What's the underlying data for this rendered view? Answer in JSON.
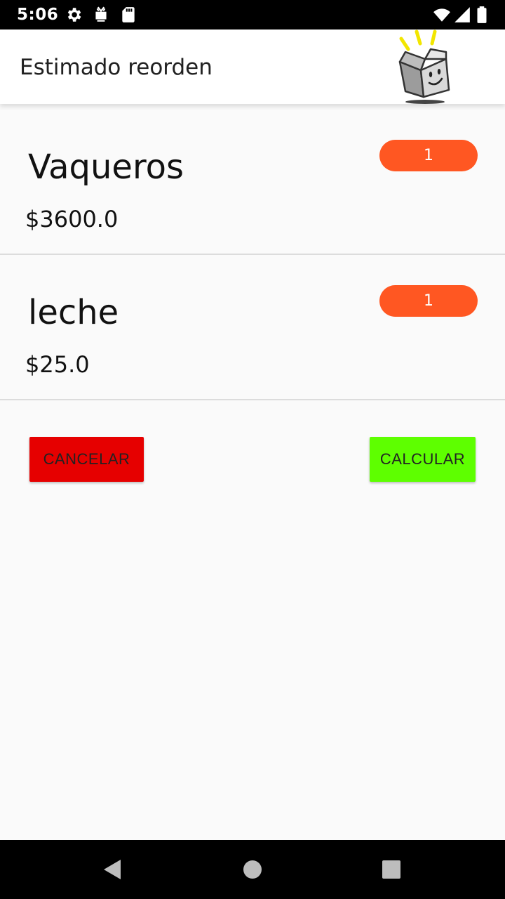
{
  "status_bar": {
    "time": "5:06",
    "icons_left": [
      "gear-icon",
      "tv-notification-icon",
      "sd-card-icon"
    ],
    "icons_right": [
      "wifi-icon",
      "cell-signal-icon",
      "battery-icon"
    ]
  },
  "app_bar": {
    "title": "Estimado reorden",
    "logo_icon": "happy-box-logo-icon"
  },
  "items": [
    {
      "name": "Vaqueros",
      "price": "$3600.0",
      "quantity": "1"
    },
    {
      "name": "leche",
      "price": "$25.0",
      "quantity": "1"
    }
  ],
  "actions": {
    "cancel_label": "CANCELAR",
    "calculate_label": "CALCULAR"
  },
  "colors": {
    "badge": "#ff5722",
    "cancel": "#e60000",
    "calculate": "#5eff00"
  },
  "nav_bar": {
    "icons": [
      "back-icon",
      "home-icon",
      "recents-icon"
    ]
  }
}
